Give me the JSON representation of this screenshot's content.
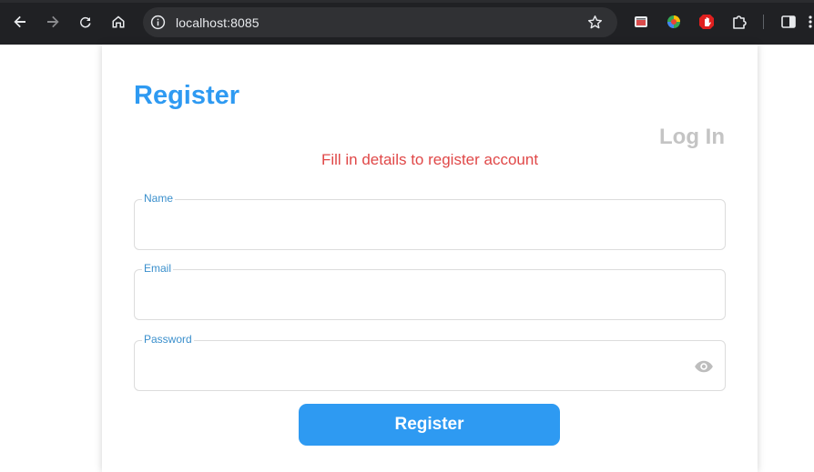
{
  "browser": {
    "url": "localhost:8085",
    "icons": [
      "back-icon",
      "forward-icon",
      "reload-icon",
      "home-icon",
      "site-info-icon",
      "bookmark-star-icon",
      "extension-icons",
      "side-panel-icon"
    ]
  },
  "form": {
    "title": "Register",
    "login_link": "Log In",
    "subtitle": "Fill in details to register account",
    "fields": {
      "name": {
        "label": "Name",
        "value": ""
      },
      "email": {
        "label": "Email",
        "value": ""
      },
      "password": {
        "label": "Password",
        "value": ""
      }
    },
    "submit_label": "Register"
  },
  "colors": {
    "accent": "#2e9af2",
    "subtitle": "#e04848",
    "muted_link": "#c4c4c4",
    "field_label": "#3a8fcc"
  }
}
